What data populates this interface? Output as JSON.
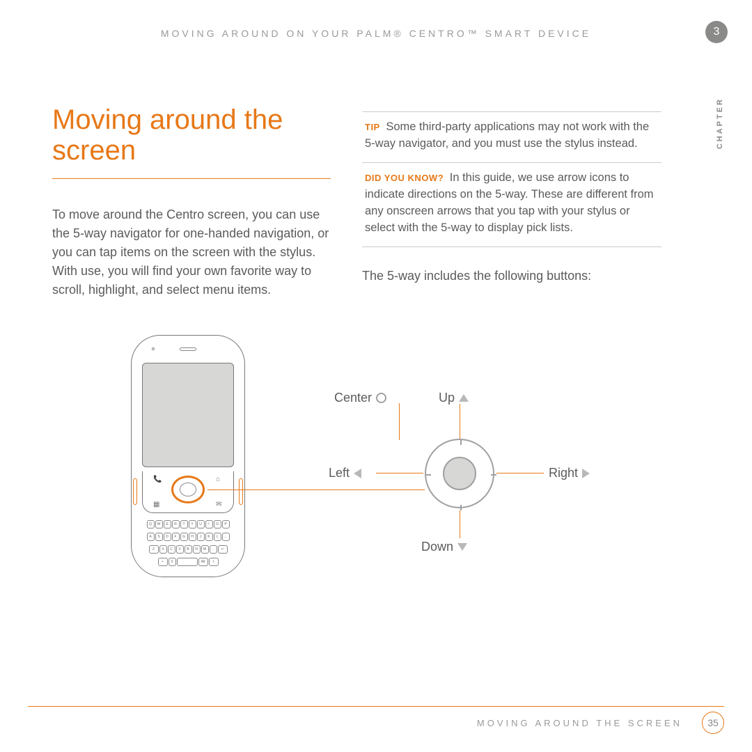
{
  "header": {
    "running_head": "MOVING AROUND ON YOUR PALM® CENTRO™ SMART DEVICE",
    "chapter_number": "3",
    "side_label": "CHAPTER"
  },
  "title": "Moving around the screen",
  "intro": "To move around the Centro screen, you can use the 5-way navigator for one-handed navigation, or you can tap items on the screen with the stylus. With use, you will find your own favorite way to scroll, highlight, and select menu items.",
  "callouts": {
    "tip_label": "TIP",
    "tip_text": "Some third-party applications may not work with the 5-way navigator, and you must use the stylus instead.",
    "dyk_label": "DID YOU KNOW?",
    "dyk_text": "In this guide, we use arrow icons to indicate directions on the 5-way. These are different from any onscreen arrows that you tap with your stylus or select with the 5-way to display pick lists."
  },
  "after_callouts": "The 5-way includes the following buttons:",
  "dpad": {
    "center": "Center",
    "up": "Up",
    "left": "Left",
    "right": "Right",
    "down": "Down"
  },
  "keyboard": {
    "row1": [
      "Q",
      "W",
      "E",
      "R",
      "T",
      "Y",
      "U",
      "I",
      "O",
      "P"
    ],
    "row2": [
      "A",
      "S",
      "D",
      "F",
      "G",
      "H",
      "J",
      "K",
      "L",
      "←"
    ],
    "row3": [
      "Z",
      "X",
      "C",
      "V",
      "B",
      "N",
      "M",
      ".",
      "↵"
    ],
    "row4_left": "•",
    "row4_0": "0",
    "row4_space": "",
    "row4_alt": "Alt",
    "row4_shift": "⇧"
  },
  "footer": {
    "text": "MOVING AROUND THE SCREEN",
    "page": "35"
  }
}
